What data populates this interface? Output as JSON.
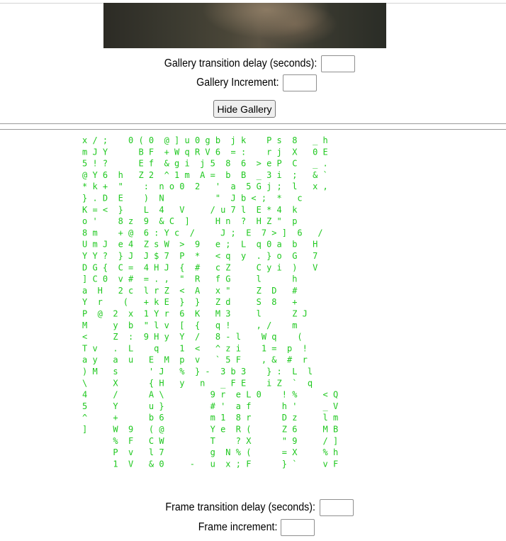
{
  "gallery": {
    "image_alt": "gallery image",
    "delay_label": "Gallery transition delay (seconds):",
    "delay_value": "",
    "increment_label": "Gallery Increment:",
    "increment_value": "",
    "hide_button": "Hide Gallery"
  },
  "frame": {
    "delay_label": "Frame transition delay (seconds):",
    "delay_value": "",
    "increment_label": "Frame increment:",
    "increment_value": ""
  },
  "matrix_rain": {
    "color": "#1fc81f",
    "lines": [
      "x / ;    0 ( 0  @ ] u 0 g b  j k    P s  8   _ h",
      "m J Y      B F  + W q R V 6  = :    r j  X   0 E",
      "5 ! ?      E f  & g i  j 5  8  6  > e P  C   _ .",
      "@ Y 6  h   Z 2  ^ 1 m  A =  b  B  _ 3 i  ;   & `",
      "* k +  \"    :  n o 0  2   '  a  5 G j ;  l   x ,",
      "} . D  E    )  N          \"  J b < ;  *   c",
      "K = <  }    L  4   V     / u 7 l  E * 4  k",
      "o '    8 z  9  & C  ]     H n  ?  H Z \"  p",
      "8 m    + @  6 : Y c  /     J ;  E  7 > ]  6   /",
      "U m J  e 4  Z s W  >  9   e ;  L  q 0 a  b   H",
      "Y Y ?  } J  J $ 7  P  *   < q  y  . } o  G   7",
      "D G {  C =  4 H J  {  #   c Z     C y i  )   V",
      "] C 0  v #  = . ,  \"  R   f G     l      h",
      "a  H   2 c  l r Z  <  A   x \"     Z  D   #",
      "Y  r    (   + k E  }  }   Z d     S  8   +",
      "P  @  2  x  1 Y r  6  K   M 3     l      Z J",
      "M     y  b  \" l v  [  {   q !     , /    m",
      "<     Z  :  9 H y  Y  /   8 - l    W q    (",
      "T v   .  L    q    1  <   ^ z i    1 =  p  !",
      "a y   a  u   E  M  p  v   ` 5 F    , &  #  r",
      ") M   s      ' J   %  } -  3 b 3    } :  L  l",
      "\\     X      { H   y   n   _ F E    i Z  `  q",
      "4     /      A \\         9 r  e L 0    ! %     < Q",
      "5     Y      u }         # '  a f      h '     _ V",
      "^     +      b 6         m 1  8 r      D z     l m",
      "]     W  9   ( @         Y e  R (      Z 6     M B",
      "      %  F   C W         T    ? X      \" 9     / ]",
      "      P  v   l 7         g  N % (      = X     % h",
      "      1  V   & 0     -   u  x ; F      } `     v F"
    ]
  }
}
